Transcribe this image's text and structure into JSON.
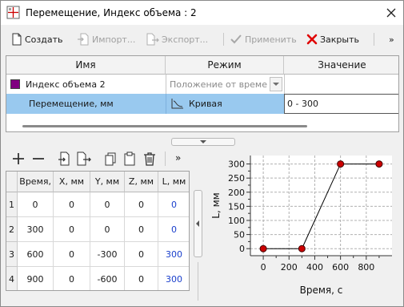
{
  "window": {
    "title": "Перемещение, Индекс объема : 2"
  },
  "toolbar": {
    "create": "Создать",
    "import": "Импорт...",
    "export": "Экспорт...",
    "apply": "Применить",
    "close": "Закрыть",
    "more": "»"
  },
  "top_table": {
    "headers": [
      "Имя",
      "Режим",
      "Значение"
    ],
    "rows": [
      {
        "name": "Индекс объема 2",
        "mode": "Положение от времени",
        "value": "",
        "swatch": "#800080"
      },
      {
        "name": "Перемещение, мм",
        "mode": "Кривая",
        "value": "0 - 300"
      }
    ],
    "selected_color": "#99c9ef"
  },
  "bottom_toolbar": {
    "more": "»"
  },
  "data_table": {
    "headers": [
      "Время,",
      "X, мм",
      "Y, мм",
      "Z, мм",
      "L, мм"
    ],
    "rows": [
      {
        "n": "1",
        "t": "0",
        "x": "0",
        "y": "0",
        "z": "0",
        "l": "0"
      },
      {
        "n": "2",
        "t": "300",
        "x": "0",
        "y": "0",
        "z": "0",
        "l": "0"
      },
      {
        "n": "3",
        "t": "600",
        "x": "0",
        "y": "-300",
        "z": "0",
        "l": "300"
      },
      {
        "n": "4",
        "t": "900",
        "x": "0",
        "y": "-600",
        "z": "0",
        "l": "300"
      }
    ]
  },
  "chart_data": {
    "type": "line",
    "xlabel": "Время, с",
    "ylabel": "L, мм",
    "x": [
      0,
      300,
      600,
      900
    ],
    "y": [
      0,
      0,
      300,
      300
    ],
    "xlim": [
      -100,
      1000
    ],
    "ylim": [
      -25,
      330
    ],
    "xticks": [
      "0",
      "200",
      "400",
      "600",
      "800"
    ],
    "yticks": [
      "0",
      "50",
      "100",
      "150",
      "200",
      "250",
      "300"
    ],
    "grid": true,
    "marker_color": "#cc0000"
  }
}
